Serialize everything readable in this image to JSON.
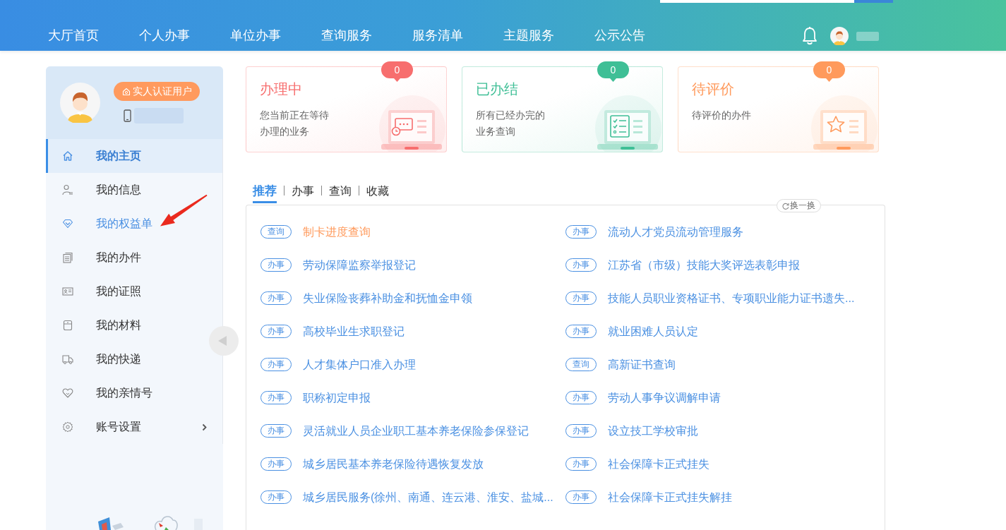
{
  "header": {
    "nav": [
      {
        "label": "大厅首页",
        "selected": false
      },
      {
        "label": "个人办事",
        "selected": false
      },
      {
        "label": "单位办事",
        "selected": false
      },
      {
        "label": "查询服务",
        "selected": false
      },
      {
        "label": "服务清单",
        "selected": false
      },
      {
        "label": "主题服务",
        "selected": false
      },
      {
        "label": "公示公告",
        "selected": false
      }
    ]
  },
  "profile": {
    "verified_label": "实人认证用户"
  },
  "sidebar": {
    "items": [
      {
        "label": "我的主页",
        "selected": true,
        "hover": false,
        "submenu": false
      },
      {
        "label": "我的信息",
        "selected": false,
        "hover": false,
        "submenu": false
      },
      {
        "label": "我的权益单",
        "selected": false,
        "hover": true,
        "submenu": false
      },
      {
        "label": "我的办件",
        "selected": false,
        "hover": false,
        "submenu": false
      },
      {
        "label": "我的证照",
        "selected": false,
        "hover": false,
        "submenu": false
      },
      {
        "label": "我的材料",
        "selected": false,
        "hover": false,
        "submenu": false
      },
      {
        "label": "我的快递",
        "selected": false,
        "hover": false,
        "submenu": false
      },
      {
        "label": "我的亲情号",
        "selected": false,
        "hover": false,
        "submenu": false
      },
      {
        "label": "账号设置",
        "selected": false,
        "hover": false,
        "submenu": true
      }
    ]
  },
  "status_cards": [
    {
      "kind": "progress",
      "title": "办理中",
      "description": "您当前正在等待办理的业务",
      "count": "0",
      "color": "#f76e6e"
    },
    {
      "kind": "done",
      "title": "已办结",
      "description": "所有已经办完的业务查询",
      "count": "0",
      "color": "#3fbf96"
    },
    {
      "kind": "rating",
      "title": "待评价",
      "description": "待评价的办件",
      "count": "0",
      "color": "#ff9a5c"
    }
  ],
  "tabs": [
    {
      "label": "推荐",
      "selected": true
    },
    {
      "label": "办事",
      "selected": false
    },
    {
      "label": "查询",
      "selected": false
    },
    {
      "label": "收藏",
      "selected": false
    }
  ],
  "refresh_button": {
    "label": "换一换"
  },
  "services": [
    {
      "tag": "查询",
      "title": "制卡进度查询",
      "hover": true
    },
    {
      "tag": "办事",
      "title": "流动人才党员流动管理服务",
      "hover": false
    },
    {
      "tag": "办事",
      "title": "劳动保障监察举报登记",
      "hover": false
    },
    {
      "tag": "办事",
      "title": "江苏省（市级）技能大奖评选表彰申报",
      "hover": false
    },
    {
      "tag": "办事",
      "title": "失业保险丧葬补助金和抚恤金申领",
      "hover": false
    },
    {
      "tag": "办事",
      "title": "技能人员职业资格证书、专项职业能力证书遗失...",
      "hover": false
    },
    {
      "tag": "办事",
      "title": "高校毕业生求职登记",
      "hover": false
    },
    {
      "tag": "办事",
      "title": "就业困难人员认定",
      "hover": false
    },
    {
      "tag": "办事",
      "title": "人才集体户口准入办理",
      "hover": false
    },
    {
      "tag": "查询",
      "title": "高新证书查询",
      "hover": false
    },
    {
      "tag": "办事",
      "title": "职称初定申报",
      "hover": false
    },
    {
      "tag": "办事",
      "title": "劳动人事争议调解申请",
      "hover": false
    },
    {
      "tag": "办事",
      "title": "灵活就业人员企业职工基本养老保险参保登记",
      "hover": false
    },
    {
      "tag": "办事",
      "title": "设立技工学校审批",
      "hover": false
    },
    {
      "tag": "办事",
      "title": "城乡居民基本养老保险待遇恢复发放",
      "hover": false
    },
    {
      "tag": "办事",
      "title": "社会保障卡正式挂失",
      "hover": false
    },
    {
      "tag": "办事",
      "title": "城乡居民服务(徐州、南通、连云港、淮安、盐城...",
      "hover": false
    },
    {
      "tag": "办事",
      "title": "社会保障卡正式挂失解挂",
      "hover": false
    }
  ]
}
